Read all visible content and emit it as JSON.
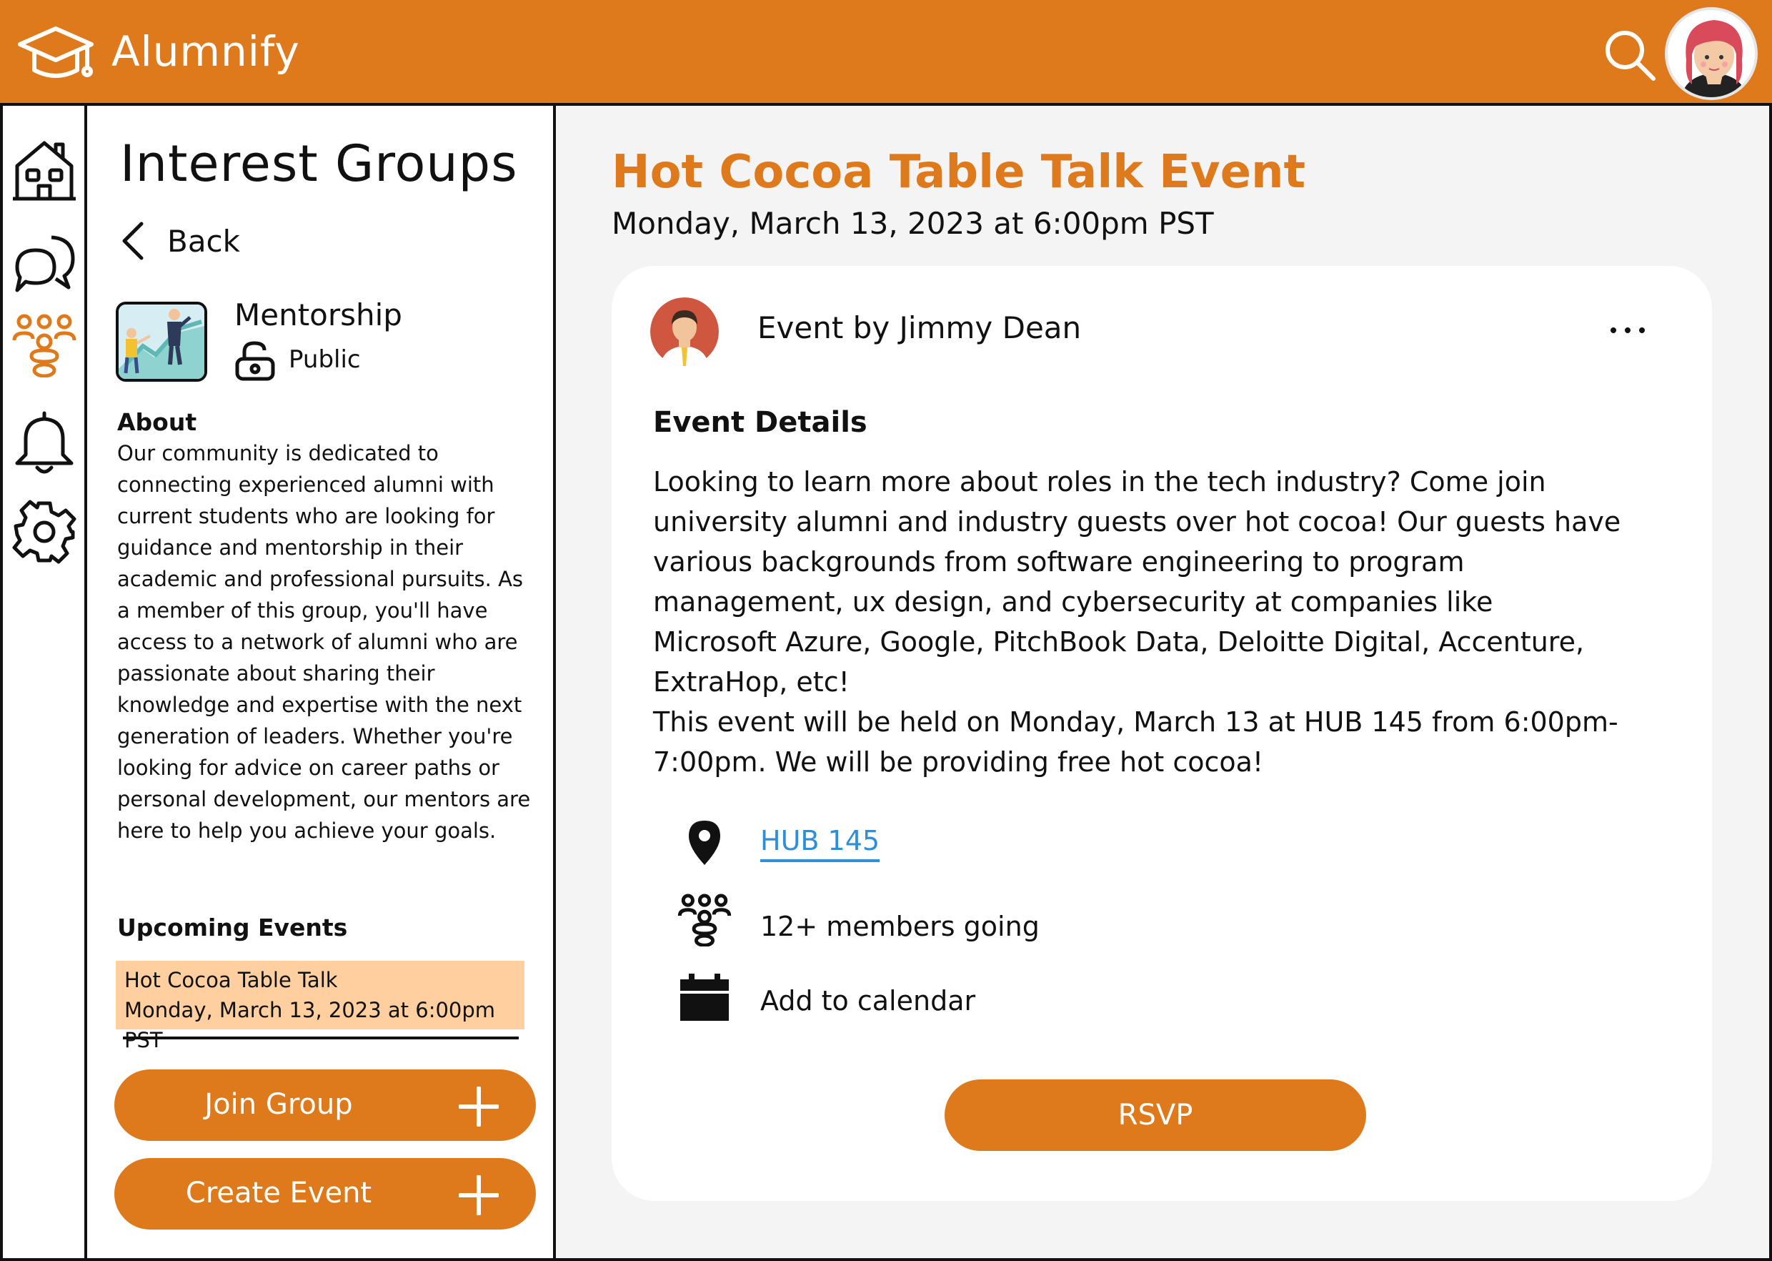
{
  "header": {
    "app_title": "Alumnify",
    "logo_icon": "graduation-cap-icon",
    "search_icon": "search-icon",
    "brand_color": "#DE7A1B"
  },
  "rail": {
    "items": [
      {
        "icon": "home-icon"
      },
      {
        "icon": "chat-bubbles-icon"
      },
      {
        "icon": "people-group-icon",
        "active": true
      },
      {
        "icon": "bell-icon"
      },
      {
        "icon": "gear-icon"
      }
    ]
  },
  "left": {
    "title": "Interest Groups",
    "back_label": "Back",
    "group": {
      "name": "Mentorship",
      "privacy": "Public"
    },
    "about_heading": "About",
    "about_text": "Our community is dedicated to connecting experienced alumni with current students who are looking for guidance and mentorship in their academic and professional pursuits. As a member of this group, you'll have access to a network of alumni who are passionate about sharing their knowledge and expertise with the next generation of leaders. Whether you're looking for advice on career paths or personal development, our mentors are here to help you achieve your goals.",
    "upcoming_heading": "Upcoming Events",
    "upcoming_events": [
      {
        "title": "Hot Cocoa Table Talk",
        "date": "Monday, March 13, 2023 at 6:00pm PST"
      }
    ],
    "join_button": "Join Group",
    "create_button": "Create Event"
  },
  "event": {
    "title": "Hot Cocoa Table Talk Event",
    "datetime": "Monday, March 13, 2023 at 6:00pm PST",
    "host": "Event by Jimmy Dean",
    "details_heading": "Event Details",
    "details_p1": "Looking to learn more about roles in the tech industry? Come join university alumni and industry guests over hot cocoa! Our guests have various backgrounds from software engineering to program management, ux design, and cybersecurity at companies like Microsoft Azure, Google, PitchBook Data, Deloitte Digital, Accenture, ExtraHop, etc!",
    "details_p2": "This event will be held on Monday, March 13 at HUB 145 from 6:00pm-7:00pm. We will be providing free hot cocoa!",
    "location": "HUB 145",
    "attendees": "12+ members going",
    "calendar": "Add to calendar",
    "rsvp": "RSVP",
    "link_color": "#2E8FD6",
    "highlight_color": "#FFCFA0"
  }
}
